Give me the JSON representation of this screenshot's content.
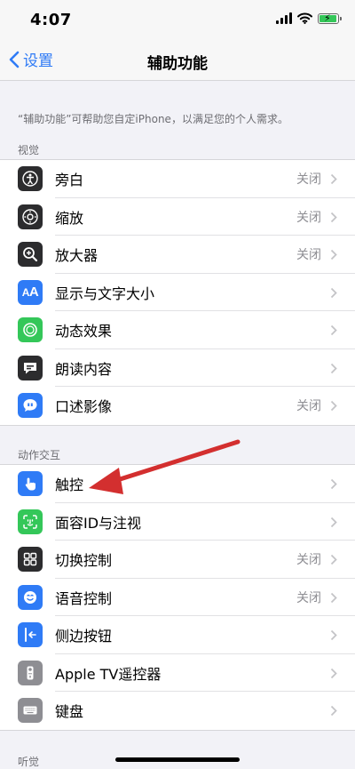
{
  "status_bar": {
    "time": "4:07"
  },
  "nav": {
    "back_label": "设置",
    "title": "辅助功能"
  },
  "description": "“辅助功能”可帮助您自定iPhone，以满足您的个人需求。",
  "sections": [
    {
      "header": "视觉",
      "rows": [
        {
          "label": "旁白",
          "value": "关闭",
          "icon": "voiceover-icon",
          "color": "#2c2c2e"
        },
        {
          "label": "缩放",
          "value": "关闭",
          "icon": "zoom-icon",
          "color": "#2c2c2e"
        },
        {
          "label": "放大器",
          "value": "关闭",
          "icon": "magnifier-icon",
          "color": "#2c2c2e"
        },
        {
          "label": "显示与文字大小",
          "value": "",
          "icon": "text-size-icon",
          "color": "#2f7bf6"
        },
        {
          "label": "动态效果",
          "value": "",
          "icon": "motion-icon",
          "color": "#34c759"
        },
        {
          "label": "朗读内容",
          "value": "",
          "icon": "spoken-content-icon",
          "color": "#2c2c2e"
        },
        {
          "label": "口述影像",
          "value": "关闭",
          "icon": "audio-description-icon",
          "color": "#2f7bf6"
        }
      ]
    },
    {
      "header": "动作交互",
      "rows": [
        {
          "label": "触控",
          "value": "",
          "icon": "touch-icon",
          "color": "#2f7bf6"
        },
        {
          "label": "面容ID与注视",
          "value": "",
          "icon": "face-id-icon",
          "color": "#34c759"
        },
        {
          "label": "切换控制",
          "value": "关闭",
          "icon": "switch-control-icon",
          "color": "#2c2c2e"
        },
        {
          "label": "语音控制",
          "value": "关闭",
          "icon": "voice-control-icon",
          "color": "#2f7bf6"
        },
        {
          "label": "侧边按钮",
          "value": "",
          "icon": "side-button-icon",
          "color": "#2f7bf6"
        },
        {
          "label": "Apple TV遥控器",
          "value": "",
          "icon": "apple-tv-remote-icon",
          "color": "#8e8e93"
        },
        {
          "label": "键盘",
          "value": "",
          "icon": "keyboard-icon",
          "color": "#8e8e93"
        }
      ]
    },
    {
      "header": "听觉",
      "rows": []
    }
  ],
  "annotation": {
    "arrow_color": "#d32f2f"
  }
}
